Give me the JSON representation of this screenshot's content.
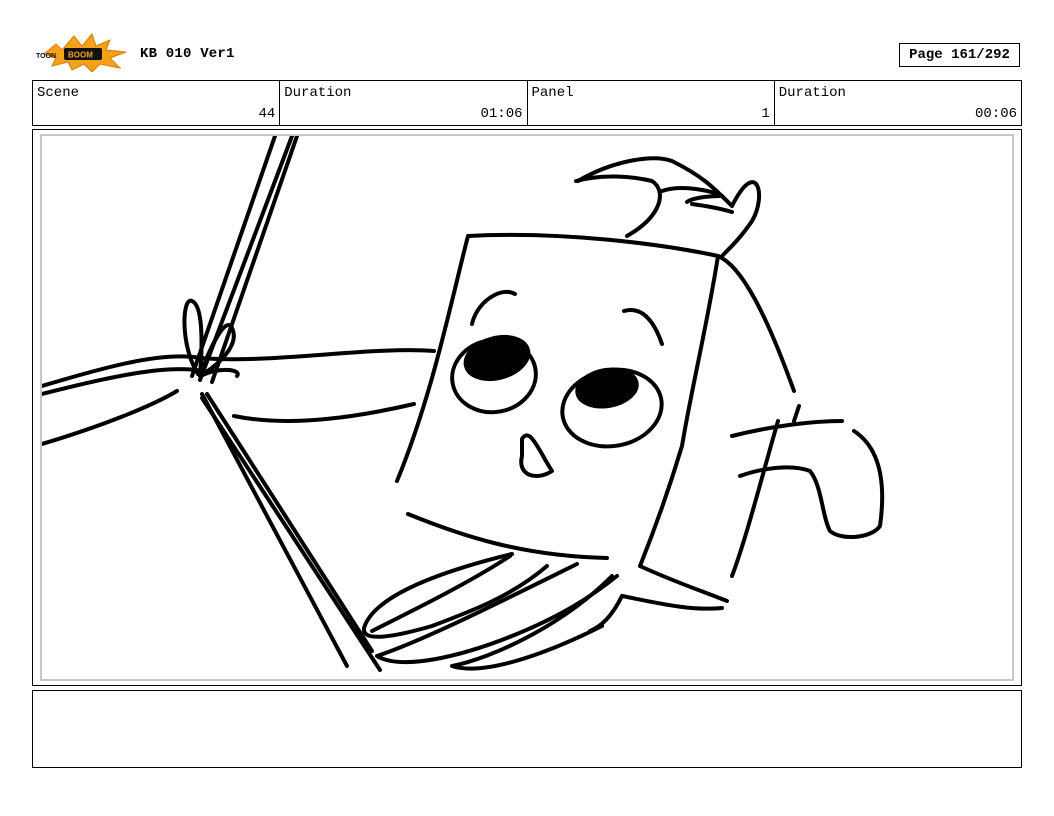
{
  "header": {
    "logo_text": "TOON BOOM",
    "project_title": "KB 010 Ver1",
    "page_label": "Page 161/292"
  },
  "info": {
    "scene_label": "Scene",
    "scene_value": "44",
    "scene_duration_label": "Duration",
    "scene_duration_value": "01:06",
    "panel_label": "Panel",
    "panel_value": "1",
    "panel_duration_label": "Duration",
    "panel_duration_value": "00:06"
  },
  "notes": {
    "text": ""
  },
  "colors": {
    "logo_orange": "#f5a21b",
    "panel_border": "#c8c8c8",
    "ink": "#000000"
  }
}
